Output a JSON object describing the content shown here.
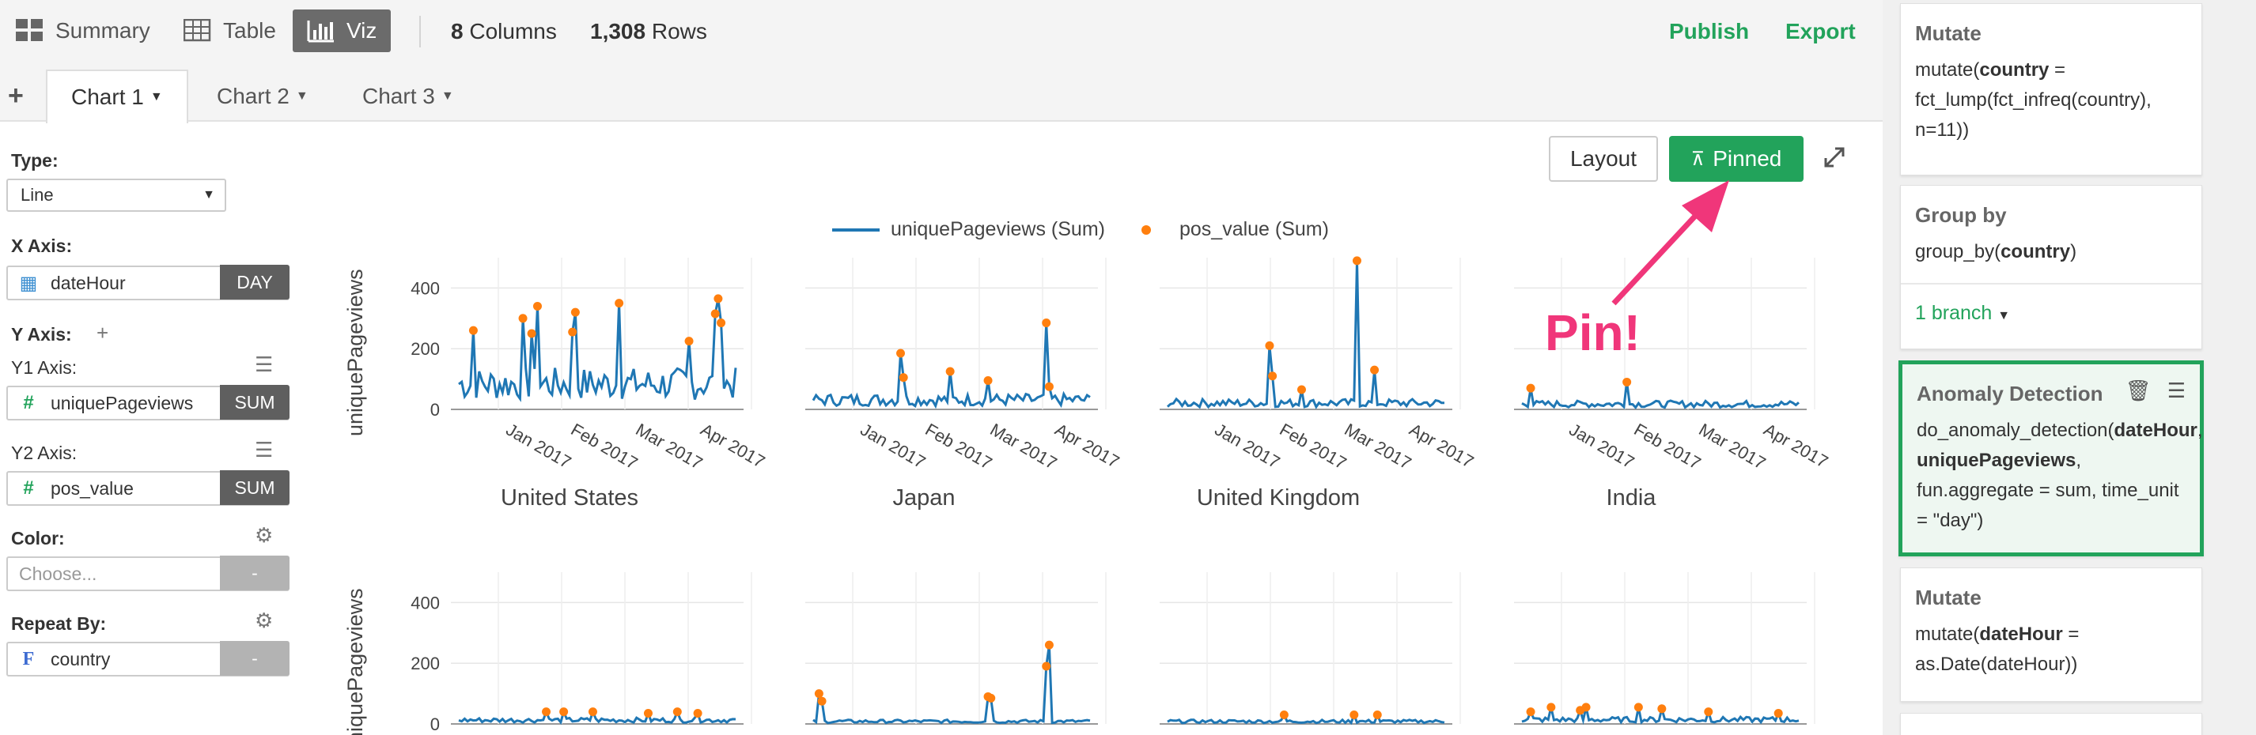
{
  "toolbar": {
    "views": [
      {
        "label": "Summary",
        "icon": "grid-icon"
      },
      {
        "label": "Table",
        "icon": "table-icon"
      },
      {
        "label": "Viz",
        "icon": "bar-chart-icon",
        "active": true
      }
    ],
    "columns_count": "8",
    "columns_label": "Columns",
    "rows_count": "1,308",
    "rows_label": "Rows",
    "publish_label": "Publish",
    "export_label": "Export"
  },
  "tabs": [
    {
      "label": "Chart 1",
      "active": true
    },
    {
      "label": "Chart 2"
    },
    {
      "label": "Chart 3"
    }
  ],
  "config": {
    "type_label": "Type:",
    "type_value": "Line",
    "x_axis_label": "X Axis:",
    "x_axis_value": "dateHour",
    "x_axis_agg": "DAY",
    "y_axis_label": "Y Axis:",
    "y1_label": "Y1 Axis:",
    "y1_value": "uniquePageviews",
    "y1_agg": "SUM",
    "y2_label": "Y2 Axis:",
    "y2_value": "pos_value",
    "y2_agg": "SUM",
    "color_label": "Color:",
    "color_placeholder": "Choose...",
    "color_agg": "-",
    "repeat_label": "Repeat By:",
    "repeat_value": "country",
    "repeat_agg": "-"
  },
  "chart_buttons": {
    "layout_label": "Layout",
    "pinned_label": "Pinned"
  },
  "annotation": "Pin!",
  "colors": {
    "accent_green": "#22a35b",
    "line_blue": "#1f77b4",
    "point_orange": "#ff7f0e",
    "pin_pink": "#f0367a"
  },
  "chart_data": {
    "type": "line",
    "legend": [
      "uniquePageviews (Sum)",
      "pos_value (Sum)"
    ],
    "legend_position": "top-center",
    "ylabel": "uniquePageviews",
    "ylim": [
      0,
      500
    ],
    "yticks": [
      "0",
      "200",
      "400"
    ],
    "xticks": [
      "Jan 2017",
      "Feb 2017",
      "Mar 2017",
      "Apr 2017"
    ],
    "grid": true,
    "facets": [
      {
        "name": "United States",
        "peak": 355,
        "noise": 120,
        "anomalies": [
          [
            5,
            260
          ],
          [
            22,
            300
          ],
          [
            25,
            250
          ],
          [
            27,
            340
          ],
          [
            39,
            255
          ],
          [
            40,
            320
          ],
          [
            55,
            350
          ],
          [
            79,
            225
          ],
          [
            88,
            315
          ],
          [
            89,
            365
          ],
          [
            90,
            285
          ]
        ]
      },
      {
        "name": "Japan",
        "peak": 285,
        "noise": 45,
        "anomalies": [
          [
            30,
            185
          ],
          [
            31,
            105
          ],
          [
            47,
            125
          ],
          [
            60,
            95
          ],
          [
            80,
            285
          ],
          [
            81,
            75
          ]
        ]
      },
      {
        "name": "United Kingdom",
        "peak": 490,
        "noise": 30,
        "anomalies": [
          [
            35,
            210
          ],
          [
            36,
            110
          ],
          [
            46,
            65
          ],
          [
            65,
            490
          ],
          [
            71,
            130
          ]
        ]
      },
      {
        "name": "India",
        "peak": 90,
        "noise": 25,
        "anomalies": [
          [
            3,
            70
          ],
          [
            36,
            90
          ]
        ]
      },
      {
        "name": "",
        "peak": 40,
        "noise": 18,
        "anomalies": [
          [
            30,
            40
          ],
          [
            36,
            40
          ],
          [
            46,
            40
          ],
          [
            65,
            35
          ],
          [
            75,
            40
          ],
          [
            82,
            35
          ]
        ]
      },
      {
        "name": "",
        "peak": 250,
        "noise": 12,
        "anomalies": [
          [
            2,
            100
          ],
          [
            3,
            75
          ],
          [
            60,
            90
          ],
          [
            61,
            85
          ],
          [
            80,
            190
          ],
          [
            81,
            260
          ]
        ]
      },
      {
        "name": "",
        "peak": 30,
        "noise": 12,
        "anomalies": [
          [
            40,
            30
          ],
          [
            64,
            30
          ],
          [
            72,
            30
          ]
        ]
      },
      {
        "name": "",
        "peak": 55,
        "noise": 20,
        "anomalies": [
          [
            3,
            40
          ],
          [
            10,
            55
          ],
          [
            20,
            45
          ],
          [
            22,
            55
          ],
          [
            40,
            55
          ],
          [
            48,
            50
          ],
          [
            64,
            40
          ],
          [
            88,
            35
          ]
        ]
      }
    ]
  },
  "pipeline": [
    {
      "title": "Mutate",
      "code": "mutate(<b>country</b> = fct_lump(fct_infreq(country), n=11))"
    },
    {
      "title": "Group by",
      "code": "group_by(<b>country</b>)",
      "branch": "1 branch"
    },
    {
      "title": "Anomaly Detection",
      "code": "do_anomaly_detection(<b>dateHour</b>, <b>uniquePageviews</b>, fun.aggregate = sum, time_unit = \"day\")"
    },
    {
      "title": "Mutate",
      "code": "mutate(<b>dateHour</b> = as.Date(dateHour))"
    }
  ]
}
